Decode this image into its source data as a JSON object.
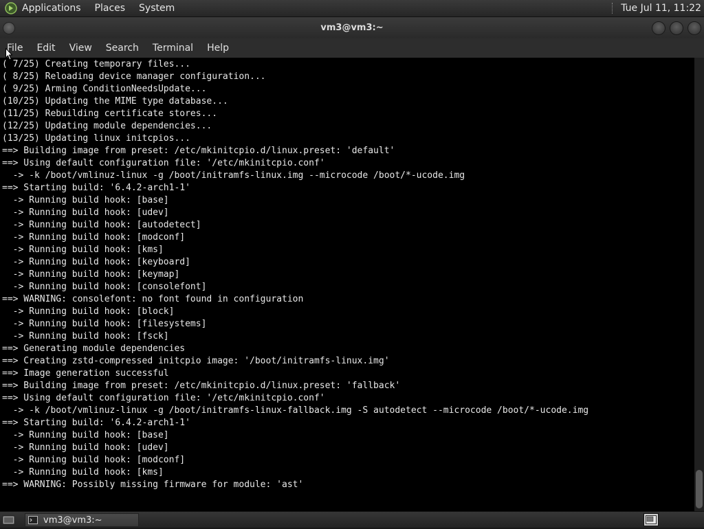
{
  "top_panel": {
    "menus": [
      "Applications",
      "Places",
      "System"
    ],
    "clock": "Tue Jul 11, 11:22"
  },
  "window": {
    "title": "vm3@vm3:~"
  },
  "menubar": {
    "items": [
      "File",
      "Edit",
      "View",
      "Search",
      "Terminal",
      "Help"
    ]
  },
  "terminal": {
    "lines": [
      "( 7/25) Creating temporary files...",
      "( 8/25) Reloading device manager configuration...",
      "( 9/25) Arming ConditionNeedsUpdate...",
      "(10/25) Updating the MIME type database...",
      "(11/25) Rebuilding certificate stores...",
      "(12/25) Updating module dependencies...",
      "(13/25) Updating linux initcpios...",
      "==> Building image from preset: /etc/mkinitcpio.d/linux.preset: 'default'",
      "==> Using default configuration file: '/etc/mkinitcpio.conf'",
      "  -> -k /boot/vmlinuz-linux -g /boot/initramfs-linux.img --microcode /boot/*-ucode.img",
      "==> Starting build: '6.4.2-arch1-1'",
      "  -> Running build hook: [base]",
      "  -> Running build hook: [udev]",
      "  -> Running build hook: [autodetect]",
      "  -> Running build hook: [modconf]",
      "  -> Running build hook: [kms]",
      "  -> Running build hook: [keyboard]",
      "  -> Running build hook: [keymap]",
      "  -> Running build hook: [consolefont]",
      "==> WARNING: consolefont: no font found in configuration",
      "  -> Running build hook: [block]",
      "  -> Running build hook: [filesystems]",
      "  -> Running build hook: [fsck]",
      "==> Generating module dependencies",
      "==> Creating zstd-compressed initcpio image: '/boot/initramfs-linux.img'",
      "==> Image generation successful",
      "==> Building image from preset: /etc/mkinitcpio.d/linux.preset: 'fallback'",
      "==> Using default configuration file: '/etc/mkinitcpio.conf'",
      "  -> -k /boot/vmlinuz-linux -g /boot/initramfs-linux-fallback.img -S autodetect --microcode /boot/*-ucode.img",
      "==> Starting build: '6.4.2-arch1-1'",
      "  -> Running build hook: [base]",
      "  -> Running build hook: [udev]",
      "  -> Running build hook: [modconf]",
      "  -> Running build hook: [kms]",
      "==> WARNING: Possibly missing firmware for module: 'ast'"
    ]
  },
  "bottom_panel": {
    "task_label": "vm3@vm3:~"
  },
  "icons": {
    "menu_logo": "mate-logo-icon",
    "desktop": "show-desktop-icon",
    "task": "terminal-icon",
    "workspace": "workspace-switcher-icon"
  }
}
